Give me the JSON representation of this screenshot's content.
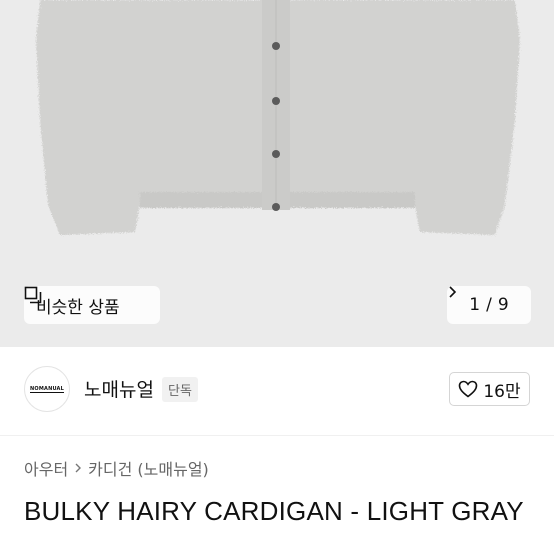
{
  "gallery": {
    "similar_label": "비슷한 상품",
    "pager_current": "1",
    "pager_sep": "/",
    "pager_total": "9"
  },
  "brand": {
    "logo_text": "NOMANUAL",
    "name": "노매뉴얼",
    "tag": "단독",
    "like_count": "16만"
  },
  "breadcrumb": {
    "level1": "아우터",
    "level2": "카디건 (노매뉴얼)"
  },
  "product": {
    "title": "BULKY HAIRY CARDIGAN - LIGHT GRAY"
  }
}
